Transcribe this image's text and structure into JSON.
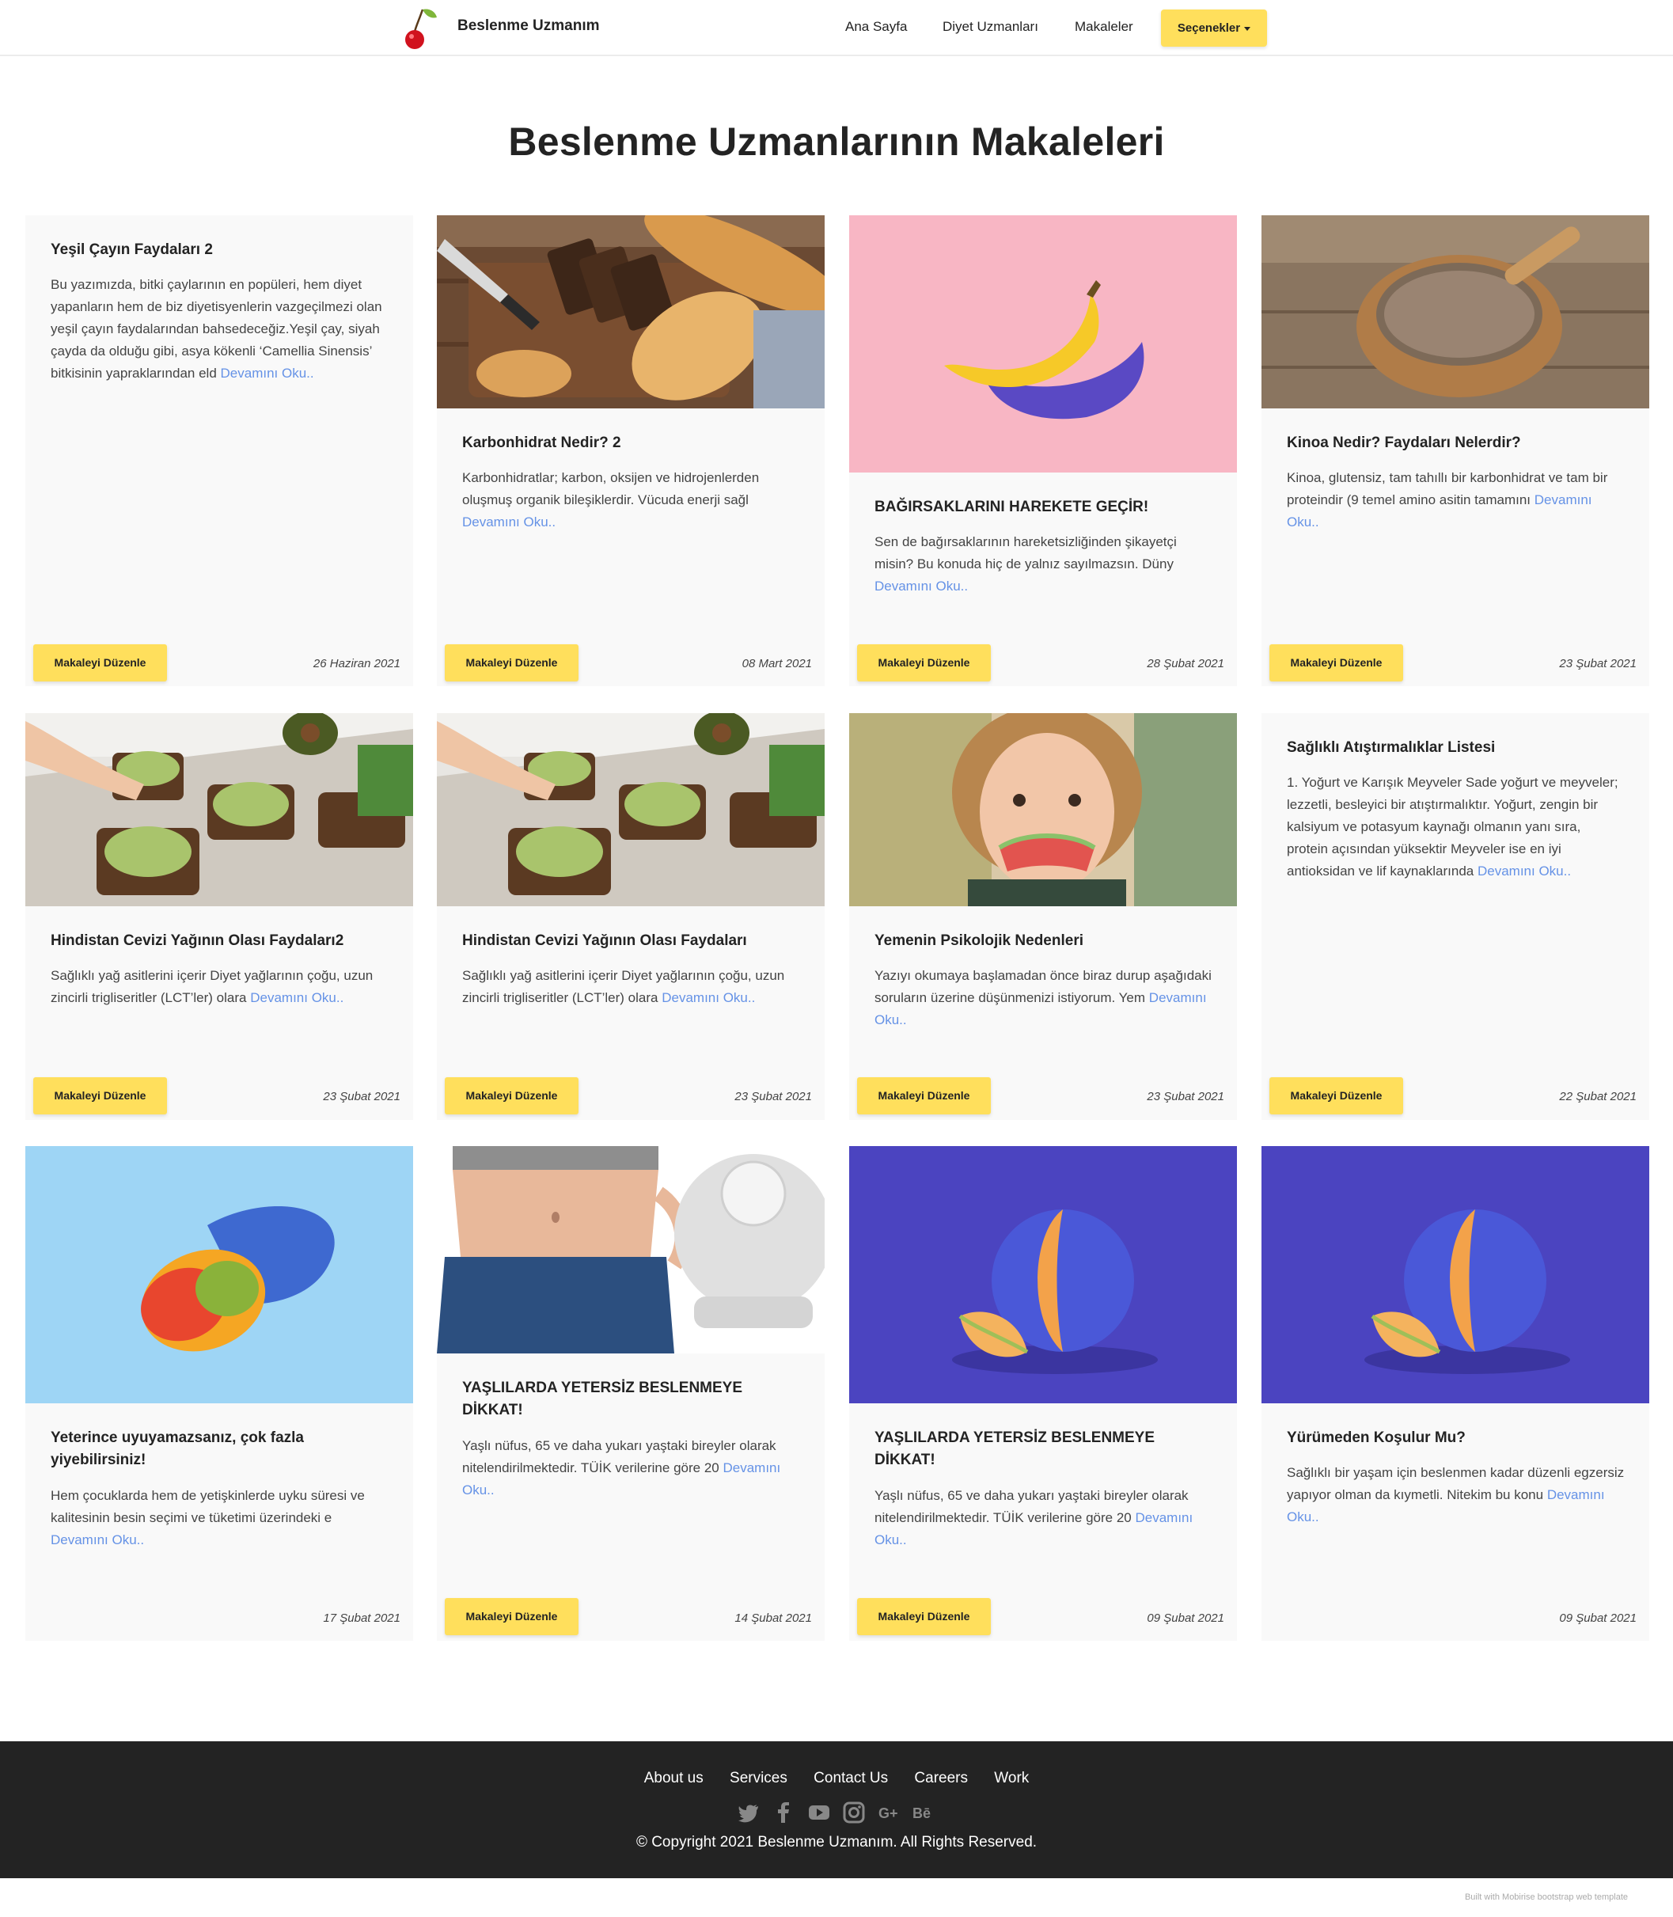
{
  "navbar": {
    "brand": "Beslenme Uzmanım",
    "links": [
      "Ana Sayfa",
      "Diyet Uzmanları",
      "Makaleler"
    ],
    "dropdown": "Seçenekler"
  },
  "page_title": "Beslenme Uzmanlarının Makaleleri",
  "read_more": "Devamını Oku..",
  "edit_label": "Makaleyi Düzenle",
  "cards": [
    {
      "title": "Yeşil Çayın Faydaları 2",
      "text": "Bu yazımızda, bitki çaylarının en popüleri, hem diyet yapanların hem de biz diyetisyenlerin vazgeçilmezi olan yeşil çayın faydalarından bahsedeceğiz.Yeşil çay, siyah çayda da olduğu gibi, asya kökenli ‘Camellia Sinensis’ bitkisinin yapraklarından eld",
      "date": "26 Haziran 2021",
      "image": "none"
    },
    {
      "title": "Karbonhidrat Nedir? 2",
      "text": "Karbonhidratlar; karbon, oksijen ve hidrojenlerden oluşmuş organik bileşiklerdir. Vücuda enerji sağl",
      "date": "08 Mart 2021",
      "image": "bread-photo"
    },
    {
      "title": "BAĞIRSAKLARINI HAREKETE GEÇİR!",
      "text": "Sen de bağırsaklarının hareketsizliğinden şikayetçi misin? Bu konuda hiç de yalnız sayılmazsın. Düny",
      "date": "28 Şubat 2021",
      "image": "banana-photo"
    },
    {
      "title": "Kinoa Nedir? Faydaları Nelerdir?",
      "text": "Kinoa, glutensiz, tam tahıllı bir karbonhidrat ve tam bir proteindir (9 temel amino asitin tamamını",
      "date": "23 Şubat 2021",
      "image": "quinoa-photo"
    },
    {
      "title": "Hindistan Cevizi Yağının Olası Faydaları2",
      "text": "Sağlıklı yağ asitlerini içerir Diyet yağlarının çoğu, uzun zincirli trigliseritler (LCT’ler) olara",
      "date": "23 Şubat 2021",
      "image": "avocado-toast-photo"
    },
    {
      "title": "Hindistan Cevizi Yağının Olası Faydaları",
      "text": "Sağlıklı yağ asitlerini içerir Diyet yağlarının çoğu, uzun zincirli trigliseritler (LCT’ler) olara",
      "date": "23 Şubat 2021",
      "image": "avocado-toast-photo"
    },
    {
      "title": "Yemenin Psikolojik Nedenleri",
      "text": "Yazıyı okumaya başlamadan önce biraz durup aşağıdaki soruların üzerine düşünmenizi istiyorum. Yem",
      "date": "23 Şubat 2021",
      "image": "child-eating-photo"
    },
    {
      "title": "Sağlıklı Atıştırmalıklar Listesi",
      "text": "1. Yoğurt ve Karışık Meyveler Sade yoğurt ve meyveler; lezzetli, besleyici bir atıştırmalıktır. Yoğurt, zengin bir kalsiyum ve potasyum kaynağı olmanın yanı sıra, protein açısından yüksektir Meyveler ise en iyi antioksidan ve lif kaynaklarında",
      "date": "22 Şubat 2021",
      "image": "none"
    },
    {
      "title": "Yeterince uyuyamazsanız, çok fazla yiyebilirsiniz!",
      "text": "Hem çocuklarda hem de yetişkinlerde uyku süresi ve kalitesinin besin seçimi ve tüketimi üzerindeki e",
      "date": "17 Şubat 2021",
      "image": "mango-photo"
    },
    {
      "title": "YAŞLILARDA YETERSİZ BESLENMEYE DİKKAT!",
      "text": "Yaşlı nüfus, 65 ve daha yukarı yaştaki bireyler olarak nitelendirilmektedir. TÜİK verilerine göre 20",
      "date": "14 Şubat 2021",
      "image": "weight-loss-photo"
    },
    {
      "title": "YAŞLILARDA YETERSİZ BESLENMEYE DİKKAT!",
      "text": "Yaşlı nüfus, 65 ve daha yukarı yaştaki bireyler olarak nitelendirilmektedir. TÜİK verilerine göre 20",
      "date": "09 Şubat 2021",
      "image": "melon-photo"
    },
    {
      "title": "Yürümeden Koşulur Mu?",
      "text": "Sağlıklı bir yaşam için beslenmen kadar düzenli egzersiz yapıyor olman da kıymetli. Nitekim bu konu",
      "date": "09 Şubat 2021",
      "image": "melon-photo"
    }
  ],
  "footer": {
    "links": [
      "About us",
      "Services",
      "Contact Us",
      "Careers",
      "Work"
    ],
    "social_icons": [
      "twitter-icon",
      "facebook-icon",
      "youtube-icon",
      "instagram-icon",
      "google-plus-icon",
      "behance-icon"
    ],
    "copyright": "© Copyright 2021 Beslenme Uzmanım. All Rights Reserved."
  },
  "built_with": "Built with Mobirise bootstrap web template",
  "colors": {
    "accent": "#ffdf5c",
    "link": "#6592e6",
    "footer_bg": "#232323",
    "card_bg": "#f9f9f9"
  }
}
